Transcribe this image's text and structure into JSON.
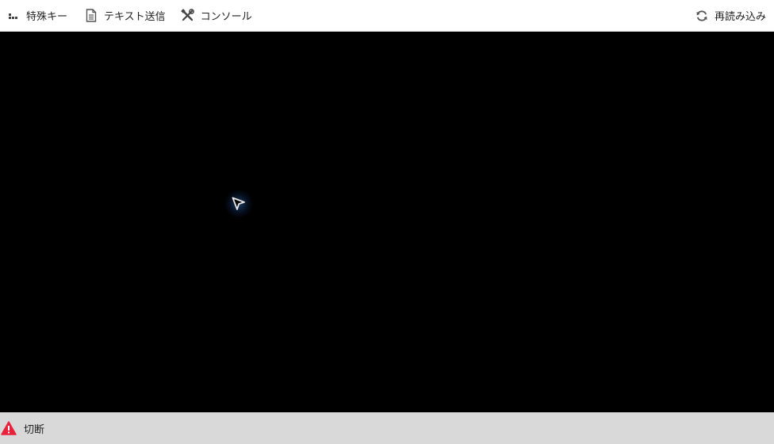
{
  "toolbar": {
    "items": [
      {
        "label": "特殊キー",
        "icon": "special-keys-icon"
      },
      {
        "label": "テキスト送信",
        "icon": "document-icon"
      },
      {
        "label": "コンソール",
        "icon": "tools-icon"
      }
    ],
    "reload": {
      "label": "再読み込み",
      "icon": "refresh-icon"
    }
  },
  "status": {
    "text": "切断",
    "icon": "warning-icon",
    "icon_color": "#e8223d"
  },
  "colors": {
    "toolbar_bg": "#ffffff",
    "screen_bg": "#000000",
    "statusbar_bg": "#d9d9d9"
  }
}
